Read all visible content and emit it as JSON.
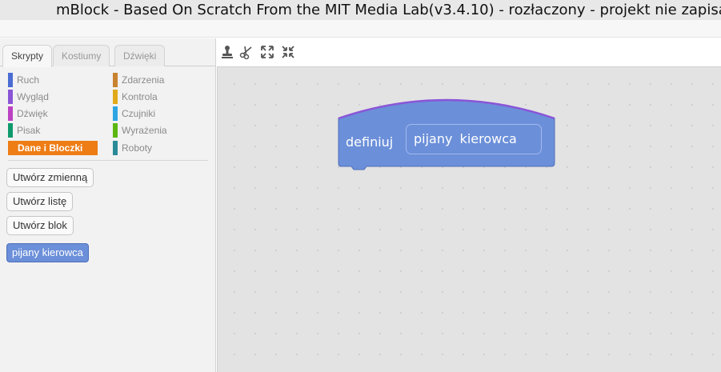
{
  "window": {
    "title": "mBlock - Based On Scratch From the MIT Media Lab(v3.4.10) - rozłaczony - projekt nie zapisany"
  },
  "tabs": [
    {
      "label": "Skrypty",
      "active": true
    },
    {
      "label": "Kostiumy",
      "active": false
    },
    {
      "label": "Dźwięki",
      "active": false
    }
  ],
  "categories": {
    "left": [
      {
        "label": "Ruch",
        "color": "#4a6cd4"
      },
      {
        "label": "Wygląd",
        "color": "#8a55d7"
      },
      {
        "label": "Dźwięk",
        "color": "#bb42c3"
      },
      {
        "label": "Pisak",
        "color": "#0e9a6c"
      },
      {
        "label": "Dane i Bloczki",
        "color": "#ee7d16",
        "selected": true
      }
    ],
    "right": [
      {
        "label": "Zdarzenia",
        "color": "#c88330"
      },
      {
        "label": "Kontrola",
        "color": "#e1a91a"
      },
      {
        "label": "Czujniki",
        "color": "#2ca5e2"
      },
      {
        "label": "Wyrażenia",
        "color": "#5cb712"
      },
      {
        "label": "Roboty",
        "color": "#2a8a98"
      }
    ]
  },
  "palette": {
    "make_variable": "Utwórz zmienną",
    "make_list": "Utwórz listę",
    "make_block": "Utwórz blok",
    "custom_block": "pijany kierowca"
  },
  "toolbar": {
    "icons": [
      "duplicate-stamp-icon",
      "delete-scissors-icon",
      "grow-icon",
      "shrink-icon"
    ]
  },
  "script": {
    "define_label": "definiuj",
    "block_name": "pijany kierowca"
  },
  "colors": {
    "more_blocks": "#6b8fd9",
    "selected_category": "#ee7d16"
  }
}
